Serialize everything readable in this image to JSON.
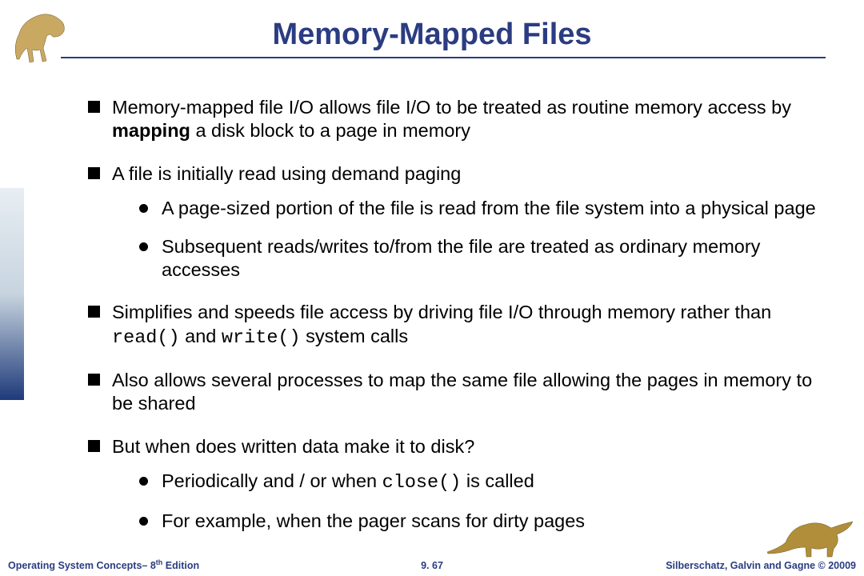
{
  "title": "Memory-Mapped Files",
  "bullets": {
    "b1_pre": "Memory-mapped file I/O allows file I/O to be treated as routine memory access by ",
    "b1_bold": "mapping",
    "b1_post": " a disk block to a page in memory",
    "b2": "A file is initially read using demand paging",
    "b2_sub1": "A page-sized portion of the file is read from the file system into a physical page",
    "b2_sub2": "Subsequent reads/writes to/from the file are treated as ordinary memory accesses",
    "b3_pre": "Simplifies and speeds file access by driving file I/O through memory rather than ",
    "b3_c1": "read()",
    "b3_mid": " and ",
    "b3_c2": "write()",
    "b3_post": " system calls",
    "b4": "Also allows several processes to map the same file allowing the pages in memory to be shared",
    "b5": "But when does written data make it to disk?",
    "b5_sub1_pre": "Periodically and / or when ",
    "b5_sub1_code": "close()",
    "b5_sub1_post": " is called",
    "b5_sub2": "For example, when the pager scans for dirty pages"
  },
  "footer": {
    "left_pre": "Operating System Concepts– 8",
    "left_sup": "th",
    "left_post": " Edition",
    "center": "9. 67",
    "right": "Silberschatz, Galvin and Gagne © 20009"
  }
}
